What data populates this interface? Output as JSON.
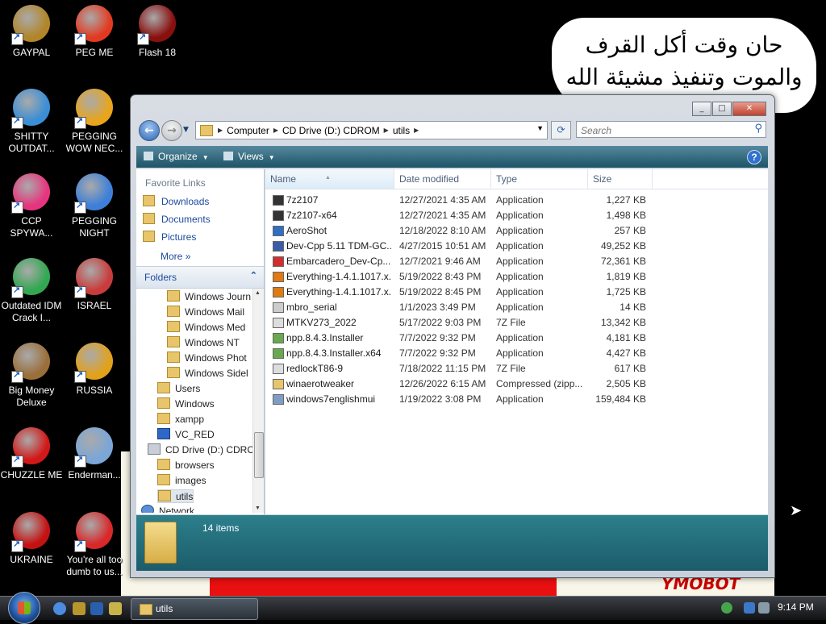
{
  "desktop": {
    "arabic_note_line1": "حان وقت أكل القرف",
    "arabic_note_line2": "والموت وتنفيذ مشيئة الله",
    "bg_text": "YMOBOT",
    "icons": [
      {
        "label": "GAYPAL",
        "color": "#b1862a"
      },
      {
        "label": "PEG ME",
        "color": "#e23a21"
      },
      {
        "label": "Flash 18",
        "color": "#8a1010"
      },
      {
        "label": "SHITTY OUTDAT...",
        "color": "#3b8ed6"
      },
      {
        "label": "PEGGING WOW NEC...",
        "color": "#e8a51c"
      },
      {
        "label": "CCP SPYWA...",
        "color": "#e6357e"
      },
      {
        "label": "PEGGING NIGHT",
        "color": "#3d7fd9"
      },
      {
        "label": "Outdated IDM Crack I...",
        "color": "#32a852"
      },
      {
        "label": "ISRAEL",
        "color": "#c93c3c"
      },
      {
        "label": "Big Money Deluxe",
        "color": "#9a6f3b"
      },
      {
        "label": "RUSSIA",
        "color": "#e2a11a"
      },
      {
        "label": "CHUZZLE ME",
        "color": "#d21818"
      },
      {
        "label": "Enderman...",
        "color": "#7aa6d8"
      },
      {
        "label": "UKRAINE",
        "color": "#c41212"
      },
      {
        "label": "You're all too dumb to us...",
        "color": "#d8282a"
      }
    ]
  },
  "window": {
    "buttons": {
      "minimize": "_",
      "maximize": "□",
      "close": "✕"
    },
    "nav": {
      "back": "←",
      "forward": "→"
    },
    "breadcrumb": [
      "Computer",
      "CD Drive (D:) CDROM",
      "utils"
    ],
    "refresh_glyph": "⟳",
    "search_placeholder": "Search",
    "toolbar": {
      "organize": "Organize",
      "views": "Views",
      "help": "?"
    },
    "favorite_links": {
      "title": "Favorite Links",
      "items": [
        "Downloads",
        "Documents",
        "Pictures"
      ],
      "more": "More"
    },
    "folders_header": "Folders",
    "tree": [
      "Windows Journ",
      "Windows Mail",
      "Windows Med",
      "Windows NT",
      "Windows Phot",
      "Windows Sidel",
      "Users",
      "Windows",
      "xampp",
      "VC_RED",
      "CD Drive (D:) CDROM",
      "browsers",
      "images",
      "utils",
      "Network"
    ],
    "columns": {
      "name": "Name",
      "date": "Date modified",
      "type": "Type",
      "size": "Size"
    },
    "files": [
      {
        "name": "7z2107",
        "date": "12/27/2021 4:35 AM",
        "type": "Application",
        "size": "1,227 KB",
        "icon": "#333333"
      },
      {
        "name": "7z2107-x64",
        "date": "12/27/2021 4:35 AM",
        "type": "Application",
        "size": "1,498 KB",
        "icon": "#333333"
      },
      {
        "name": "AeroShot",
        "date": "12/18/2022 8:10 AM",
        "type": "Application",
        "size": "257 KB",
        "icon": "#2f6fc4"
      },
      {
        "name": "Dev-Cpp 5.11 TDM-GC...",
        "date": "4/27/2015 10:51 AM",
        "type": "Application",
        "size": "49,252 KB",
        "icon": "#3b5da8"
      },
      {
        "name": "Embarcadero_Dev-Cp...",
        "date": "12/7/2021 9:46 AM",
        "type": "Application",
        "size": "72,361 KB",
        "icon": "#d22e2e"
      },
      {
        "name": "Everything-1.4.1.1017.x...",
        "date": "5/19/2022 8:43 PM",
        "type": "Application",
        "size": "1,819 KB",
        "icon": "#e07a12"
      },
      {
        "name": "Everything-1.4.1.1017.x...",
        "date": "5/19/2022 8:45 PM",
        "type": "Application",
        "size": "1,725 KB",
        "icon": "#e07a12"
      },
      {
        "name": "mbro_serial",
        "date": "1/1/2023 3:49 PM",
        "type": "Application",
        "size": "14 KB",
        "icon": "#cccccc"
      },
      {
        "name": "MTKV273_2022",
        "date": "5/17/2022 9:03 PM",
        "type": "7Z File",
        "size": "13,342 KB",
        "icon": "#dddddd"
      },
      {
        "name": "npp.8.4.3.Installer",
        "date": "7/7/2022 9:32 PM",
        "type": "Application",
        "size": "4,181 KB",
        "icon": "#6aa84f"
      },
      {
        "name": "npp.8.4.3.Installer.x64",
        "date": "7/7/2022 9:32 PM",
        "type": "Application",
        "size": "4,427 KB",
        "icon": "#6aa84f"
      },
      {
        "name": "redlockT86-9",
        "date": "7/18/2022 11:15 PM",
        "type": "7Z File",
        "size": "617 KB",
        "icon": "#dddddd"
      },
      {
        "name": "winaerotweaker",
        "date": "12/26/2022 6:15 AM",
        "type": "Compressed (zipp...",
        "size": "2,505 KB",
        "icon": "#e8c56a"
      },
      {
        "name": "windows7englishmui",
        "date": "1/19/2022 3:08 PM",
        "type": "Application",
        "size": "159,484 KB",
        "icon": "#7e9cc4"
      }
    ],
    "status": {
      "item_count": "14 items"
    }
  },
  "taskbar": {
    "task_label": "utils",
    "clock": "9:14 PM"
  }
}
